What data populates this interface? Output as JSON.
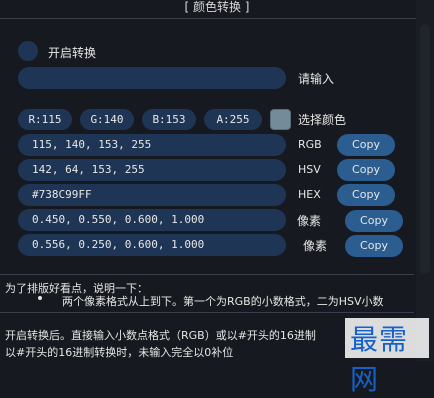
{
  "title": "[ 颜色转换 ]",
  "toggle": {
    "label": "开启转换"
  },
  "input": {
    "hint": "请输入"
  },
  "rgba": {
    "r": "R:115",
    "g": "G:140",
    "b": "B:153",
    "a": "A:255"
  },
  "pick_color": {
    "label": "选择颜色",
    "color": "#738C99"
  },
  "rows": [
    {
      "value": "115, 140, 153, 255",
      "type": "RGB",
      "button": "Copy"
    },
    {
      "value": "142, 64, 153, 255",
      "type": "HSV",
      "button": "Copy"
    },
    {
      "value": "#738C99FF",
      "type": "HEX",
      "button": "Copy"
    },
    {
      "value": "0.450, 0.550, 0.600, 1.000",
      "type": "像素",
      "button": "Copy"
    },
    {
      "value": "0.556, 0.250, 0.600, 1.000",
      "type": "像素",
      "button": "Copy"
    }
  ],
  "notes": {
    "heading": "为了排版好看点，说明一下：",
    "bullet": "两个像素格式从上到下。第一个为RGB的小数格式，二为HSV小数",
    "line1": "开启转换后。直接输入小数点格式（RGB）或以#开头的16进制",
    "line2": "以#开头的16进制转换时，未输入完全以0补位"
  },
  "watermark": "最需网"
}
